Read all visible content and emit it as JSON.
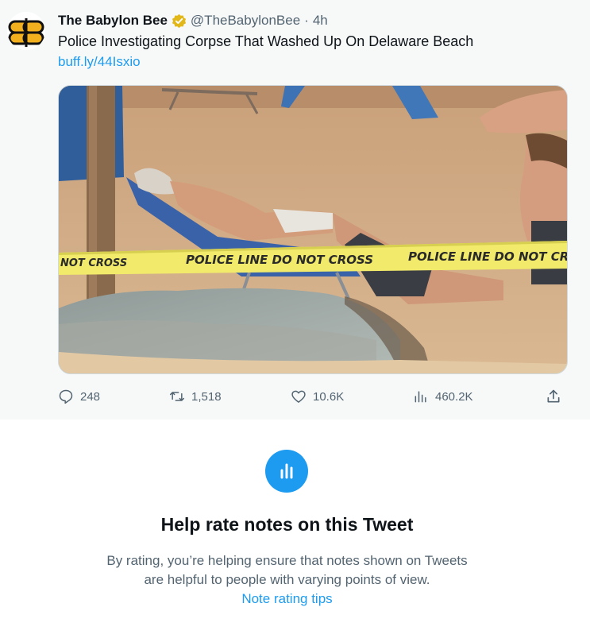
{
  "tweet": {
    "author": {
      "display_name": "The Babylon Bee",
      "handle": "@TheBabylonBee",
      "verified_badge_color": "#e2b719",
      "avatar_icon": "babylon-bee-logo"
    },
    "separator": "·",
    "timestamp": "4h",
    "text": "Police Investigating Corpse That Washed Up On Delaware Beach",
    "link": "buff.ly/44Isxio",
    "media": {
      "tape_text_left": "NOT CROSS",
      "tape_text_middle": "POLICE LINE DO NOT CROSS",
      "tape_text_right": "POLICE LINE DO NOT CROSS"
    },
    "actions": {
      "replies": "248",
      "retweets": "1,518",
      "likes": "10.6K",
      "views": "460.2K"
    }
  },
  "community_notes": {
    "title": "Help rate notes on this Tweet",
    "body_line1": "By rating, you’re helping ensure that notes shown on Tweets",
    "body_line2": "are helpful to people with varying points of view.",
    "link": "Note rating tips",
    "accent_color": "#1d9bf0"
  }
}
